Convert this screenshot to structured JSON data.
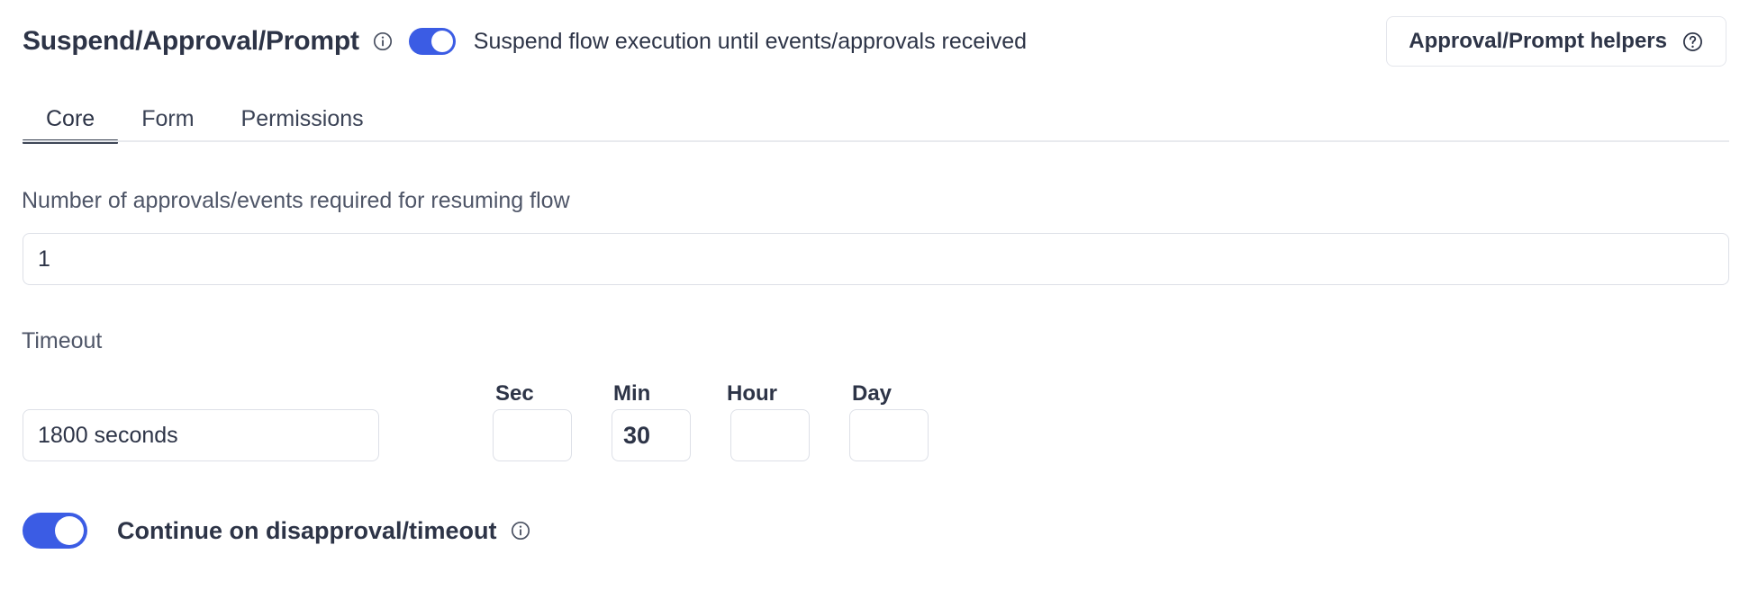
{
  "header": {
    "title": "Suspend/Approval/Prompt",
    "title_info_icon": "info-circle-icon",
    "suspend_toggle_on": true,
    "description": "Suspend flow execution until events/approvals received",
    "helpers_button_label": "Approval/Prompt helpers",
    "helpers_button_icon": "question-circle-icon"
  },
  "tabs": {
    "items": [
      {
        "label": "Core",
        "active": true
      },
      {
        "label": "Form",
        "active": false
      },
      {
        "label": "Permissions",
        "active": false
      }
    ]
  },
  "fields": {
    "approvals": {
      "label": "Number of approvals/events required for resuming flow",
      "value": "1",
      "placeholder": ""
    },
    "timeout": {
      "label": "Timeout",
      "main_value": "1800 seconds",
      "main_placeholder": "",
      "units": [
        {
          "label": "Sec",
          "value": "",
          "placeholder": ""
        },
        {
          "label": "Min",
          "value": "30",
          "placeholder": ""
        },
        {
          "label": "Hour",
          "value": "",
          "placeholder": ""
        },
        {
          "label": "Day",
          "value": "",
          "placeholder": ""
        }
      ]
    }
  },
  "continue_on_failure": {
    "toggle_on": true,
    "label": "Continue on disapproval/timeout",
    "info_icon": "info-circle-icon"
  },
  "colors": {
    "toggle_on": "#3b5ce4",
    "text_primary": "#2d3447",
    "text_secondary": "#4f5668",
    "border": "#dde0e7",
    "divider": "#e8eaee",
    "tab_underline": "#3f4757"
  }
}
